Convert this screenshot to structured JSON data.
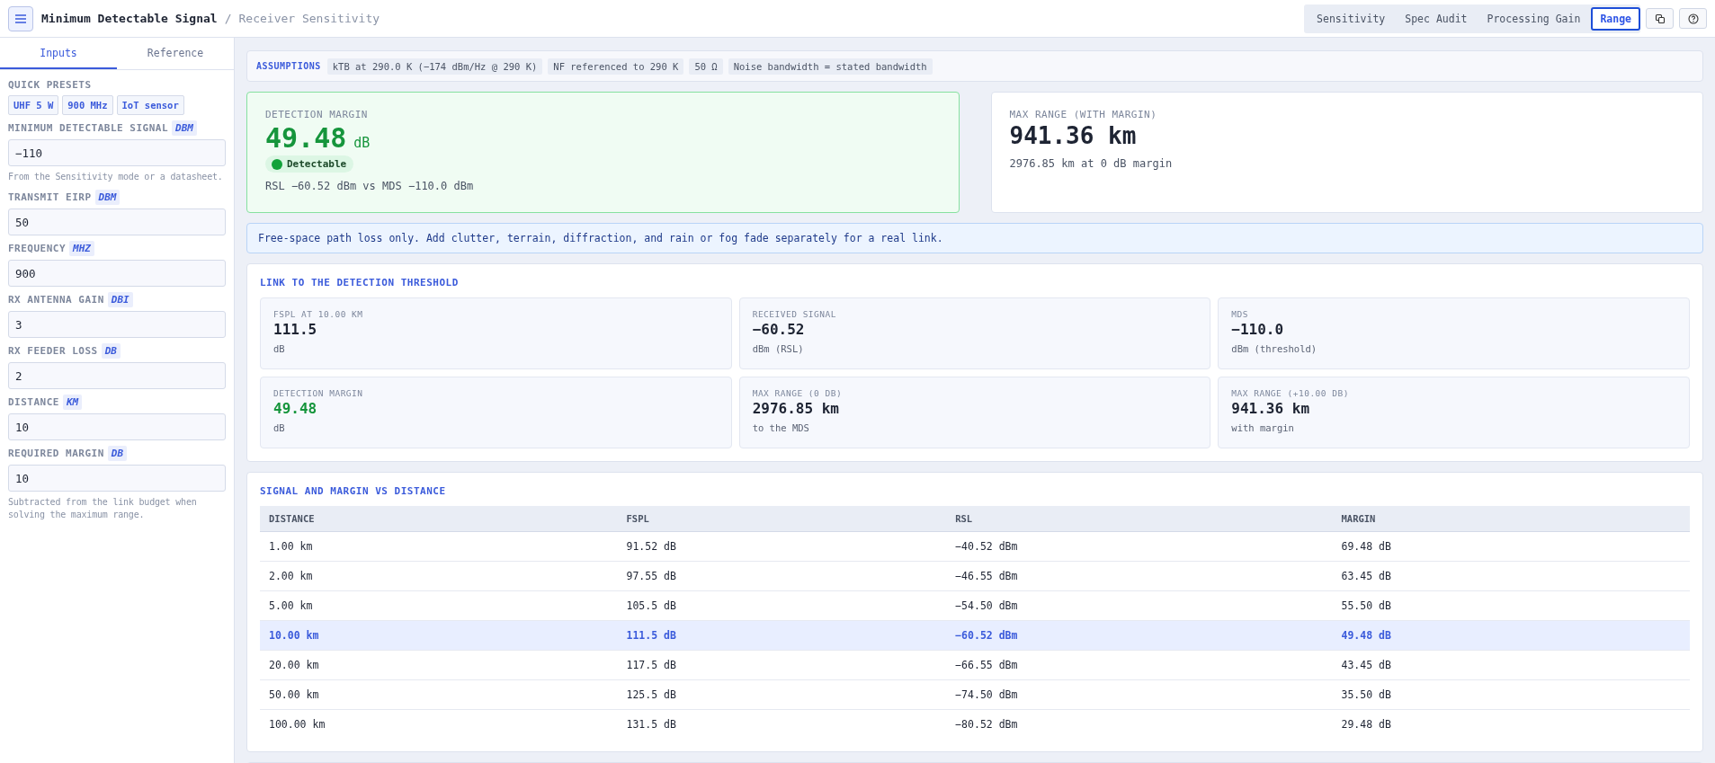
{
  "header": {
    "title": "Minimum Detectable Signal",
    "separator": "/",
    "subtitle": "Receiver Sensitivity",
    "modes": [
      {
        "label": "Sensitivity",
        "selected": false
      },
      {
        "label": "Spec Audit",
        "selected": false
      },
      {
        "label": "Processing Gain",
        "selected": false
      },
      {
        "label": "Range",
        "selected": true
      }
    ]
  },
  "sidebar": {
    "tabs": [
      {
        "label": "Inputs",
        "selected": true
      },
      {
        "label": "Reference",
        "selected": false
      }
    ],
    "presets_label": "QUICK PRESETS",
    "presets": [
      "UHF 5 W",
      "900 MHz",
      "IoT sensor"
    ],
    "fields": [
      {
        "label": "MINIMUM DETECTABLE SIGNAL",
        "unit": "DBM",
        "value": "−110",
        "hint": "From the Sensitivity mode or a datasheet."
      },
      {
        "label": "TRANSMIT EIRP",
        "unit": "DBM",
        "value": "50"
      },
      {
        "label": "FREQUENCY",
        "unit": "MHZ",
        "value": "900"
      },
      {
        "label": "RX ANTENNA GAIN",
        "unit": "DBI",
        "value": "3"
      },
      {
        "label": "RX FEEDER LOSS",
        "unit": "DB",
        "value": "2"
      },
      {
        "label": "DISTANCE",
        "unit": "KM",
        "value": "10"
      },
      {
        "label": "REQUIRED MARGIN",
        "unit": "DB",
        "value": "10",
        "hint": "Subtracted from the link budget when solving the maximum range."
      }
    ]
  },
  "assumptions": {
    "label": "ASSUMPTIONS",
    "items": [
      "kTB at 290.0 K (−174 dBm/Hz @ 290 K)",
      "NF referenced to 290 K",
      "50 Ω",
      "Noise bandwidth = stated bandwidth"
    ]
  },
  "detection": {
    "label": "DETECTION MARGIN",
    "value": "49.48",
    "unit": "dB",
    "detectable": true,
    "status": "Detectable",
    "detail": "RSL −60.52 dBm vs MDS −110.0 dBm"
  },
  "max_range": {
    "label": "MAX RANGE (WITH MARGIN)",
    "value": "941.36 km",
    "detail": "2976.85 km at 0 dB margin"
  },
  "notice": "Free-space path loss only. Add clutter, terrain, diffraction, and rain or fog fade separately for a real link.",
  "link": {
    "title": "LINK TO THE DETECTION THRESHOLD",
    "metrics": [
      {
        "label": "FSPL AT 10.00 KM",
        "value": "111.5",
        "unit": "dB",
        "positive": false
      },
      {
        "label": "RECEIVED SIGNAL",
        "value": "−60.52",
        "unit": "dBm (RSL)",
        "positive": false
      },
      {
        "label": "MDS",
        "value": "−110.0",
        "unit": "dBm (threshold)",
        "positive": false
      },
      {
        "label": "DETECTION MARGIN",
        "value": "49.48",
        "unit": "dB",
        "positive": true
      },
      {
        "label": "MAX RANGE (0 DB)",
        "value": "2976.85 km",
        "unit": "to the MDS",
        "positive": false
      },
      {
        "label": "MAX RANGE (+10.00 DB)",
        "value": "941.36 km",
        "unit": "with margin",
        "positive": false
      }
    ]
  },
  "table": {
    "title": "SIGNAL AND MARGIN VS DISTANCE",
    "columns": [
      "DISTANCE",
      "FSPL",
      "RSL",
      "MARGIN"
    ],
    "rows": [
      {
        "cells": [
          "1.00 km",
          "91.52 dB",
          "−40.52 dBm",
          "69.48 dB"
        ],
        "selected": false
      },
      {
        "cells": [
          "2.00 km",
          "97.55 dB",
          "−46.55 dBm",
          "63.45 dB"
        ],
        "selected": false
      },
      {
        "cells": [
          "5.00 km",
          "105.5 dB",
          "−54.50 dBm",
          "55.50 dB"
        ],
        "selected": false
      },
      {
        "cells": [
          "10.00 km",
          "111.5 dB",
          "−60.52 dBm",
          "49.48 dB"
        ],
        "selected": true
      },
      {
        "cells": [
          "20.00 km",
          "117.5 dB",
          "−66.55 dBm",
          "43.45 dB"
        ],
        "selected": false
      },
      {
        "cells": [
          "50.00 km",
          "125.5 dB",
          "−74.50 dBm",
          "35.50 dB"
        ],
        "selected": false
      },
      {
        "cells": [
          "100.00 km",
          "131.5 dB",
          "−80.52 dBm",
          "29.48 dB"
        ],
        "selected": false
      }
    ]
  }
}
